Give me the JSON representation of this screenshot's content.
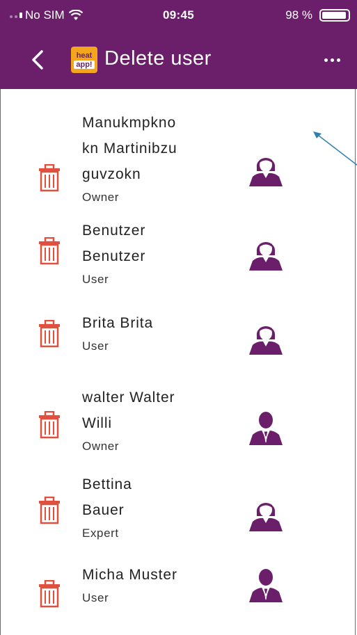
{
  "status_bar": {
    "carrier": "No SIM",
    "time": "09:45",
    "battery": "98 %"
  },
  "header": {
    "title": "Delete user",
    "logo_top": "heat",
    "logo_bottom": "app!",
    "back_icon": "chevron-left-icon",
    "menu_icon": "more-dots-icon"
  },
  "colors": {
    "header_bg": "#6b1f6a",
    "trash": "#e0503f",
    "avatar": "#6b1f6a",
    "arrow": "#2f7fb0"
  },
  "users": [
    {
      "name_lines": [
        "Manukmpkno",
        "kn Martinibzu",
        "guvzokn"
      ],
      "role": "Owner",
      "avatar": "female"
    },
    {
      "name_lines": [
        "Benutzer",
        "Benutzer"
      ],
      "role": "User",
      "avatar": "female"
    },
    {
      "name_lines": [
        "Brita Brita"
      ],
      "role": "User",
      "avatar": "female"
    },
    {
      "name_lines": [
        "walter Walter",
        "Willi"
      ],
      "role": "Owner",
      "avatar": "male"
    },
    {
      "name_lines": [
        "Bettina",
        "Bauer"
      ],
      "role": "Expert",
      "avatar": "female"
    },
    {
      "name_lines": [
        "Micha Muster"
      ],
      "role": "User",
      "avatar": "male"
    }
  ]
}
